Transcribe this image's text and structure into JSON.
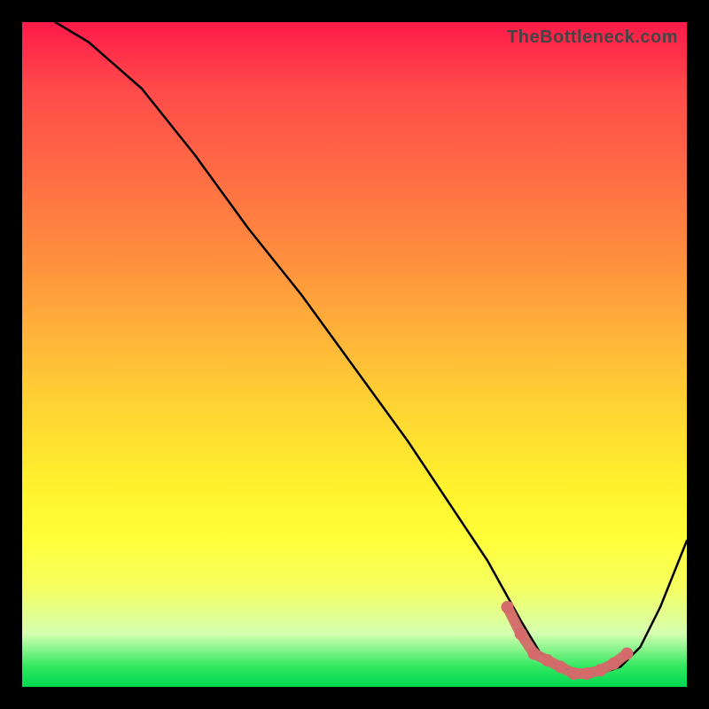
{
  "watermark": "TheBottleneck.com",
  "chart_data": {
    "type": "line",
    "title": "",
    "xlabel": "",
    "ylabel": "",
    "xlim": [
      0,
      100
    ],
    "ylim": [
      0,
      100
    ],
    "series": [
      {
        "name": "curve",
        "x": [
          5,
          10,
          18,
          26,
          34,
          42,
          50,
          58,
          64,
          70,
          75,
          78,
          81,
          84,
          87,
          90,
          93,
          96,
          100
        ],
        "y": [
          100,
          97,
          90,
          80,
          69,
          59,
          48,
          37,
          28,
          19,
          10,
          5,
          3,
          2,
          2,
          3,
          6,
          12,
          22
        ]
      }
    ],
    "highlight": {
      "name": "optimal-band",
      "color": "#d46a6a",
      "points_x": [
        73,
        75,
        77,
        79,
        81,
        83,
        85,
        87,
        89,
        91
      ],
      "points_y": [
        12,
        8,
        5,
        4,
        3,
        2,
        2,
        2.5,
        3.5,
        5
      ]
    }
  }
}
